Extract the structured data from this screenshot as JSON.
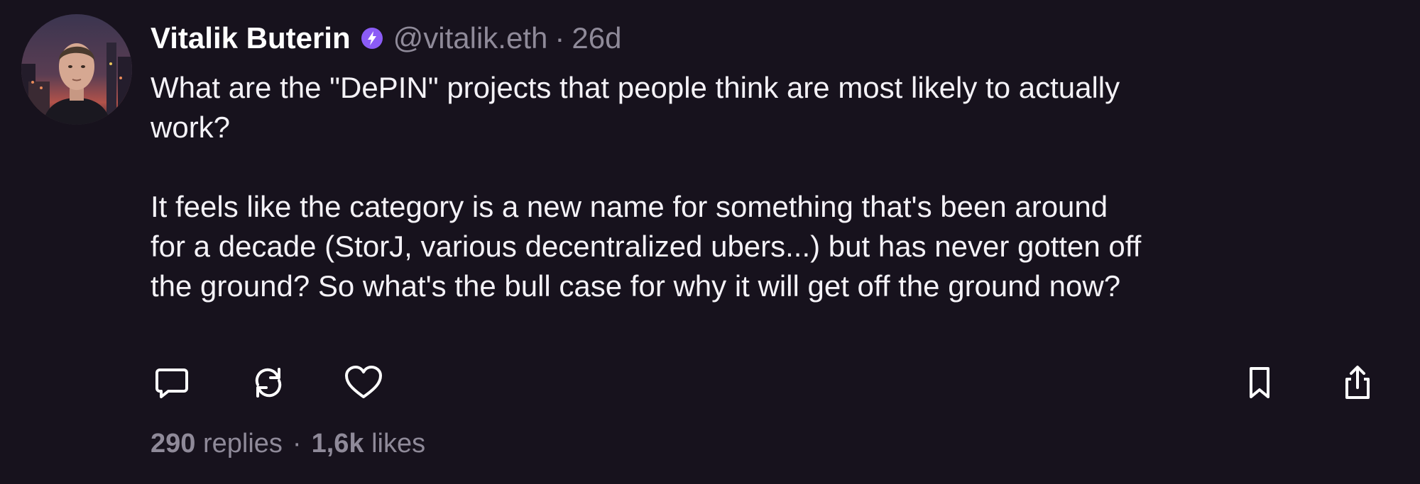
{
  "post": {
    "author_name": "Vitalik Buterin",
    "handle": "@vitalik.eth",
    "separator": "·",
    "age": "26d",
    "verified_icon": "verified-bolt-icon",
    "paragraphs": [
      [
        "What are the \"DePIN\" projects that people think are most likely to actually",
        "work?"
      ],
      [
        "It feels like the category is a new name for something that's been around",
        "for a decade (StorJ, various decentralized ubers...) but has never gotten off",
        "the ground? So what's the bull case for why it will get off the ground now?"
      ]
    ],
    "stats": {
      "replies_count": "290",
      "replies_label": "replies",
      "separator": "·",
      "likes_count": "1,6k",
      "likes_label": "likes"
    }
  },
  "actions": {
    "reply": "reply-icon",
    "repost": "repost-icon",
    "like": "heart-icon",
    "bookmark": "bookmark-icon",
    "share": "share-icon"
  },
  "colors": {
    "background": "#17121d",
    "text": "#f4f2f7",
    "muted": "#8f8a99",
    "accent": "#8b5cf6"
  }
}
